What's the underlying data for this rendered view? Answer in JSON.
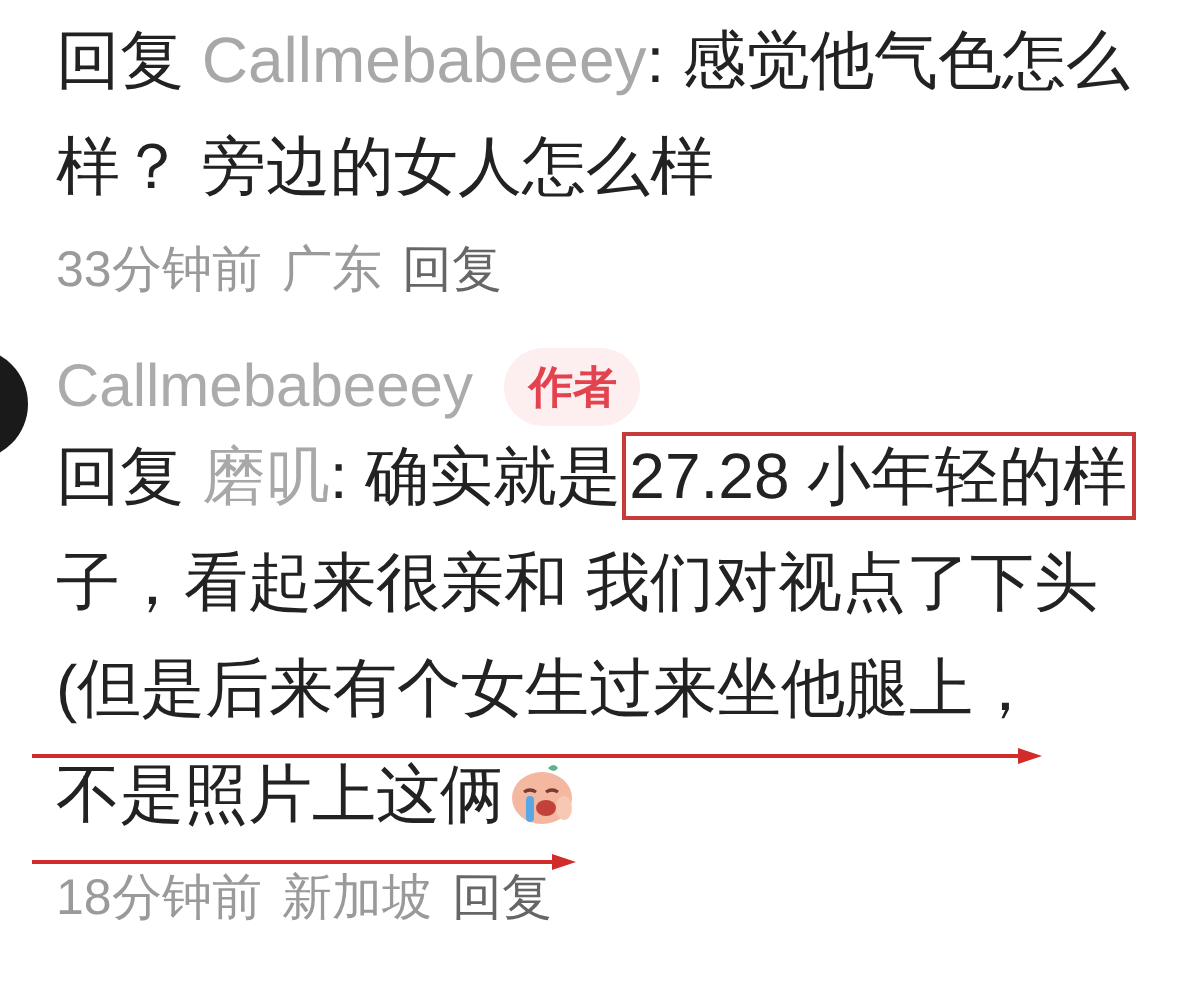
{
  "comments": [
    {
      "lines": [
        {
          "segments": [
            {
              "kind": "plain",
              "text": "回复 "
            },
            {
              "kind": "mention",
              "text": "Callmebabeeey"
            },
            {
              "kind": "plain",
              "text": ": 感觉他气色怎么"
            }
          ]
        },
        {
          "segments": [
            {
              "kind": "plain",
              "text": "样？ 旁边的女人怎么样"
            }
          ]
        }
      ],
      "meta": {
        "time": "33分钟前",
        "location": "广东",
        "reply": "回复"
      }
    },
    {
      "author": {
        "name": "Callmebabeeey",
        "badge": "作者"
      },
      "lines": [
        {
          "segments": [
            {
              "kind": "plain",
              "text": "回复 "
            },
            {
              "kind": "mention",
              "text": "磨叽"
            },
            {
              "kind": "plain",
              "text": ": 确实就是"
            },
            {
              "kind": "boxed",
              "text": "27.28 小年轻的样"
            }
          ]
        },
        {
          "segments": [
            {
              "kind": "plain",
              "text": "子，看起来很亲和 我们对视点了下头"
            }
          ]
        },
        {
          "arrow": true,
          "segments": [
            {
              "kind": "plain",
              "text": "(但是后来有个女生过来坐他腿上，"
            }
          ]
        },
        {
          "arrow": true,
          "segments": [
            {
              "kind": "plain",
              "text": "不是照片上这俩"
            },
            {
              "kind": "sticker"
            }
          ]
        }
      ],
      "meta": {
        "time": "18分钟前",
        "location": "新加坡",
        "reply": "回复"
      }
    }
  ]
}
